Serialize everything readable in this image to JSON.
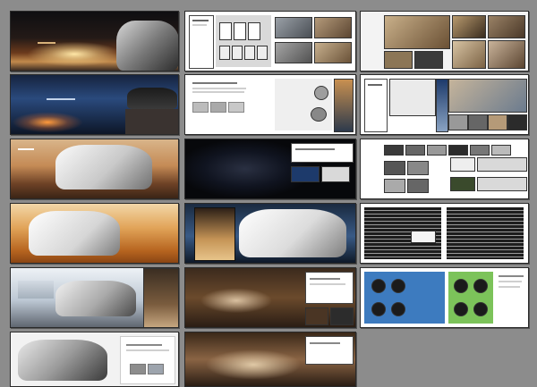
{
  "title": "",
  "grid": {
    "columns": 3,
    "rows": 6
  },
  "spreads": [
    {
      "id": "r1c1",
      "theme": "sunset hero",
      "colors": [
        "#0f0f12",
        "#5a2e1a",
        "#f7d48a"
      ]
    },
    {
      "id": "r1c2",
      "theme": "seat layouts",
      "colors": [
        "#eeeeee",
        "#ffffff",
        "#222222"
      ]
    },
    {
      "id": "r1c3",
      "theme": "interior photos",
      "colors": [
        "#f3f3f3",
        "#b89a6e",
        "#3a3a3a"
      ]
    },
    {
      "id": "r2c1",
      "theme": "city night",
      "colors": [
        "#0c1b36",
        "#2d4f86",
        "#c27a3b"
      ]
    },
    {
      "id": "r2c2",
      "theme": "tech panels",
      "colors": [
        "#ffffff",
        "#c9c9c9",
        "#333333"
      ]
    },
    {
      "id": "r2c3",
      "theme": "detail shots",
      "colors": [
        "#ffffff",
        "#6b7b8e",
        "#2b2b2b"
      ]
    },
    {
      "id": "r3c1",
      "theme": "desert rock",
      "colors": [
        "#4a2f1d",
        "#c8894e",
        "#e8d5b8"
      ]
    },
    {
      "id": "r3c2",
      "theme": "dark engine",
      "colors": [
        "#0b0d12",
        "#1d3a6b",
        "#ffffff"
      ]
    },
    {
      "id": "r3c3",
      "theme": "feature list",
      "colors": [
        "#ffffff",
        "#d9d9d9",
        "#2c2c2c"
      ]
    },
    {
      "id": "r4c1",
      "theme": "sand dunes",
      "colors": [
        "#b5621e",
        "#e8a54c",
        "#f4e0b4"
      ]
    },
    {
      "id": "r4c2",
      "theme": "white suv",
      "colors": [
        "#111a28",
        "#46648c",
        "#f5f5f5"
      ]
    },
    {
      "id": "r4c3",
      "theme": "spec tables",
      "colors": [
        "#ffffff",
        "#1d1d1d",
        "#9a9a9a"
      ]
    },
    {
      "id": "r5c1",
      "theme": "silver suv",
      "colors": [
        "#dfe6ee",
        "#9aa8b8",
        "#5c5c5c"
      ]
    },
    {
      "id": "r5c2",
      "theme": "cockpit",
      "colors": [
        "#241a12",
        "#6b4a2c",
        "#d9c0a0"
      ]
    },
    {
      "id": "r5c3",
      "theme": "wheel options",
      "colors": [
        "#ffffff",
        "#3d7bbf",
        "#7cc35a"
      ]
    },
    {
      "id": "r6c1",
      "theme": "chassis",
      "colors": [
        "#f0f0f0",
        "#9b9b9b",
        "#303030"
      ]
    },
    {
      "id": "r6c2",
      "theme": "leather seats",
      "colors": [
        "#2a1d14",
        "#8a6444",
        "#e0c9a6"
      ]
    }
  ]
}
